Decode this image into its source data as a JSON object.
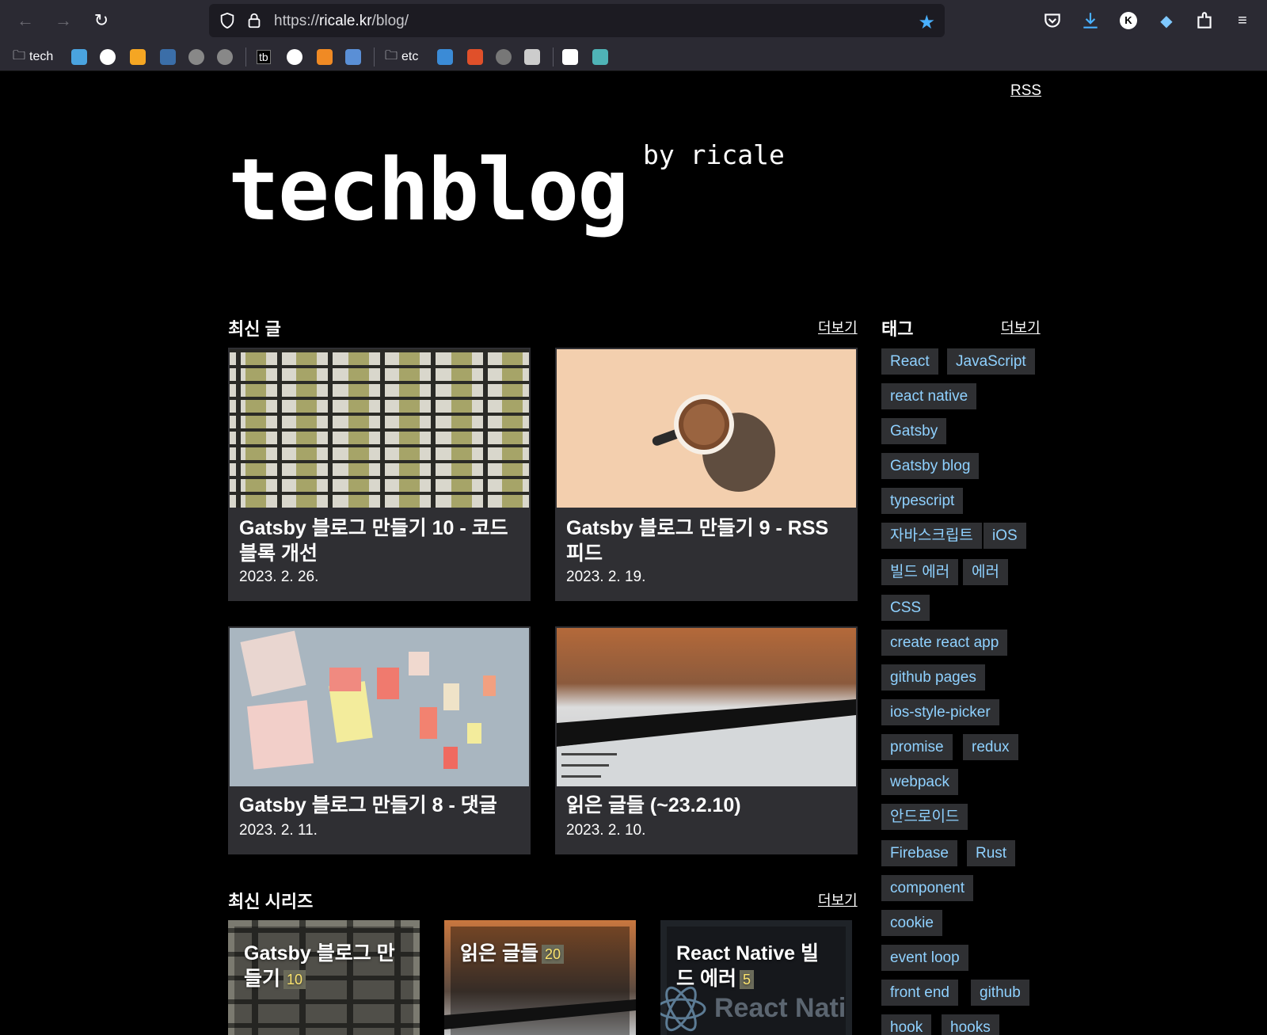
{
  "browser": {
    "url_scheme": "https://",
    "url_host": "ricale.kr",
    "url_path": "/blog/",
    "bookmarks": {
      "folder_tech": "tech",
      "tb": "tb",
      "folder_etc": "etc"
    }
  },
  "header": {
    "rss": "RSS",
    "logo": "techblog",
    "byline": "by ricale"
  },
  "latest_posts": {
    "title": "최신 글",
    "more": "더보기",
    "posts": [
      {
        "title": "Gatsby 블로그 만들기 10 - 코드블록 개선",
        "date": "2023. 2. 26."
      },
      {
        "title": "Gatsby 블로그 만들기 9 - RSS 피드",
        "date": "2023. 2. 19."
      },
      {
        "title": "Gatsby 블로그 만들기 8 - 댓글",
        "date": "2023. 2. 11."
      },
      {
        "title": "읽은 글들 (~23.2.10)",
        "date": "2023. 2. 10."
      }
    ]
  },
  "latest_series": {
    "title": "최신 시리즈",
    "more": "더보기",
    "items": [
      {
        "title": "Gatsby 블로그 만들기",
        "count": "10"
      },
      {
        "title": "읽은 글들",
        "count": "20"
      },
      {
        "title": "React Native 빌드 에러",
        "count": "5",
        "watermark": "React Nati"
      }
    ]
  },
  "tags": {
    "title": "태그",
    "more": "더보기",
    "items": [
      "React",
      "JavaScript",
      "react native",
      "Gatsby",
      "Gatsby blog",
      "typescript",
      "자바스크립트",
      "iOS",
      "빌드 에러",
      "에러",
      "CSS",
      "create react app",
      "github pages",
      "ios-style-picker",
      "promise",
      "redux",
      "webpack",
      "안드로이드",
      "Firebase",
      "Rust",
      "component",
      "cookie",
      "event loop",
      "front end",
      "github",
      "hook",
      "hooks"
    ]
  },
  "colors": {
    "tag_text": "#8fd1ff",
    "card_bg": "#2f2f33",
    "accent_star": "#49b0ff"
  }
}
